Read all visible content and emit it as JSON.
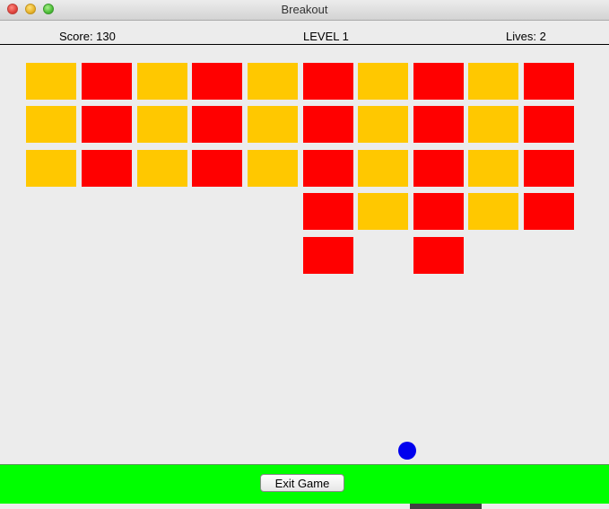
{
  "window": {
    "title": "Breakout"
  },
  "hud": {
    "score": "Score: 130",
    "level": "LEVEL 1",
    "lives": "Lives: 2"
  },
  "colors": {
    "yellow": "#ffc800",
    "red": "#ff0000",
    "ball": "#0000ee",
    "paddle": "#424242",
    "bottom_bar": "#00ff00"
  },
  "bricks": [
    [
      "yellow",
      "red",
      "yellow",
      "red",
      "yellow",
      "red",
      "yellow",
      "red",
      "yellow",
      "red"
    ],
    [
      "yellow",
      "red",
      "yellow",
      "red",
      "yellow",
      "red",
      "yellow",
      "red",
      "yellow",
      "red"
    ],
    [
      "yellow",
      "red",
      "yellow",
      "red",
      "yellow",
      "red",
      "yellow",
      "red",
      "yellow",
      "red"
    ],
    [
      null,
      null,
      null,
      null,
      null,
      "red",
      "yellow",
      "red",
      "yellow",
      "red"
    ],
    [
      null,
      null,
      null,
      null,
      null,
      "red",
      null,
      "red",
      null,
      null
    ]
  ],
  "controls": {
    "exit_label": "Exit Game"
  }
}
